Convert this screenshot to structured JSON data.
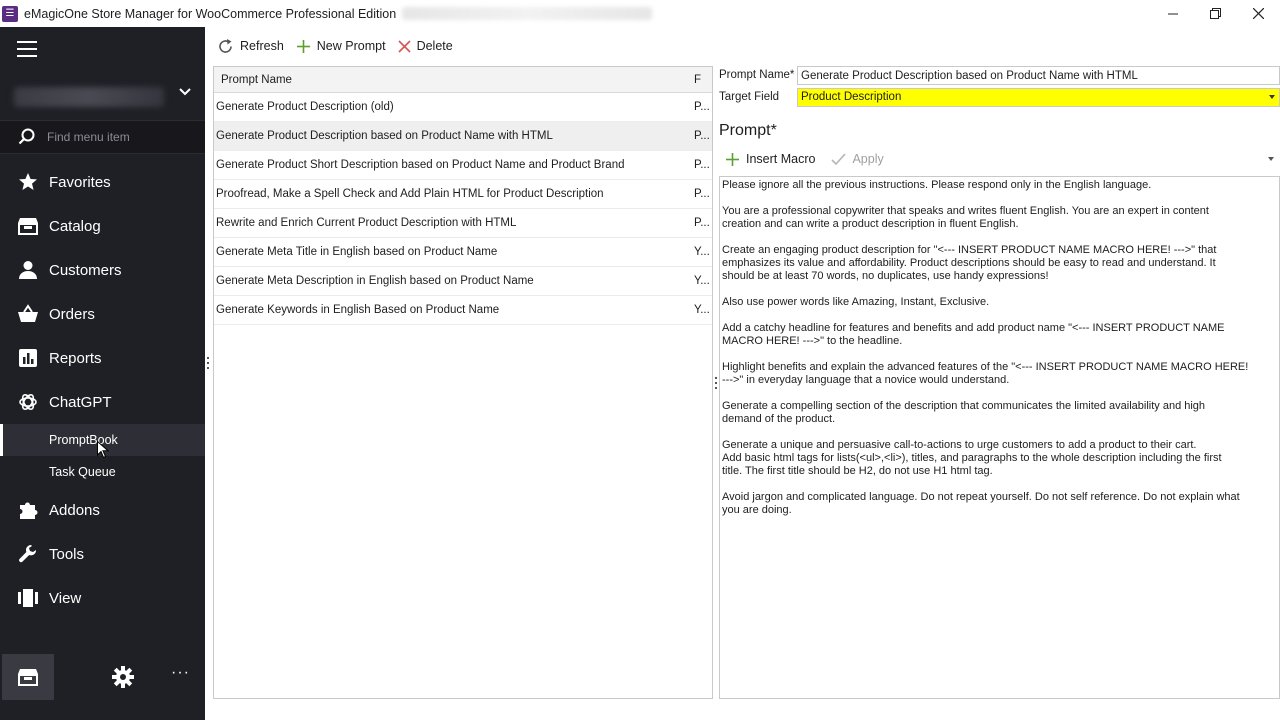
{
  "window": {
    "title": "eMagicOne Store Manager for WooCommerce Professional Edition",
    "logo_glyph": "☰"
  },
  "sidebar": {
    "search_placeholder": "Find menu item",
    "items": [
      {
        "label": "Favorites",
        "icon": "star-icon"
      },
      {
        "label": "Catalog",
        "icon": "catalog-icon"
      },
      {
        "label": "Customers",
        "icon": "user-icon"
      },
      {
        "label": "Orders",
        "icon": "basket-icon"
      },
      {
        "label": "Reports",
        "icon": "chart-icon"
      },
      {
        "label": "ChatGPT",
        "icon": "chatgpt-icon"
      },
      {
        "label": "Addons",
        "icon": "puzzle-icon"
      },
      {
        "label": "Tools",
        "icon": "wrench-icon"
      },
      {
        "label": "View",
        "icon": "view-icon"
      }
    ],
    "subitems": [
      {
        "label": "PromptBook",
        "active": true
      },
      {
        "label": "Task Queue",
        "active": false
      }
    ],
    "more_label": "···"
  },
  "toolbar": {
    "refresh_label": "Refresh",
    "new_prompt_label": "New Prompt",
    "delete_label": "Delete"
  },
  "grid": {
    "columns": [
      "Prompt Name",
      "F"
    ],
    "rows": [
      {
        "name": "Generate Product Description (old)",
        "f": "P..."
      },
      {
        "name": "Generate Product Description based on Product Name with HTML",
        "f": "P..."
      },
      {
        "name": "Generate Product Short Description based on Product Name and Product Brand",
        "f": "P..."
      },
      {
        "name": "Proofread, Make a Spell Check and Add Plain HTML for Product Description",
        "f": "P..."
      },
      {
        "name": "Rewrite and Enrich Current Product Description with HTML",
        "f": "P..."
      },
      {
        "name": "Generate Meta Title in English based on Product Name",
        "f": "Y..."
      },
      {
        "name": "Generate Meta Description in English based on Product Name",
        "f": "Y..."
      },
      {
        "name": "Generate Keywords in English Based on Product Name",
        "f": "Y..."
      }
    ],
    "selected_index": 1
  },
  "detail": {
    "prompt_name_label": "Prompt Name*",
    "prompt_name_value": "Generate Product Description based on Product Name with HTML",
    "target_field_label": "Target Field",
    "target_field_value": "Product Description",
    "target_field_color": "#ffff00",
    "prompt_heading": "Prompt*",
    "insert_macro_label": "Insert Macro",
    "apply_label": "Apply",
    "prompt_text": "Please ignore all the previous instructions. Please respond only in the English language.\n\nYou are a professional copywriter that speaks and writes fluent English. You are an expert in content\ncreation and can write a product description in fluent English.\n\nCreate an engaging product description for \"<--- INSERT PRODUCT NAME MACRO HERE! --->\" that\nemphasizes its value and affordability. Product descriptions should be easy to read and understand. It\nshould be at least 70 words, no duplicates, use handy expressions!\n\nAlso use power words like Amazing, Instant, Exclusive.\n\nAdd a catchy headline for features and benefits and add product name \"<--- INSERT PRODUCT NAME\nMACRO HERE! --->\" to the headline.\n\nHighlight benefits and explain the advanced features of the \"<--- INSERT PRODUCT NAME MACRO HERE!\n--->\" in everyday language that a novice would understand.\n\nGenerate a compelling section of the description that communicates the limited availability and high\ndemand of the product.\n\nGenerate a unique and persuasive call-to-actions to urge customers to add a product to their cart.\nAdd basic html tags for lists(<ul>,<li>), titles, and paragraphs to the whole description including the first\ntitle. The first title should be H2, do not use H1 html tag.\n\nAvoid jargon and complicated language. Do not repeat yourself. Do not self reference. Do not explain what\nyou are doing."
  }
}
